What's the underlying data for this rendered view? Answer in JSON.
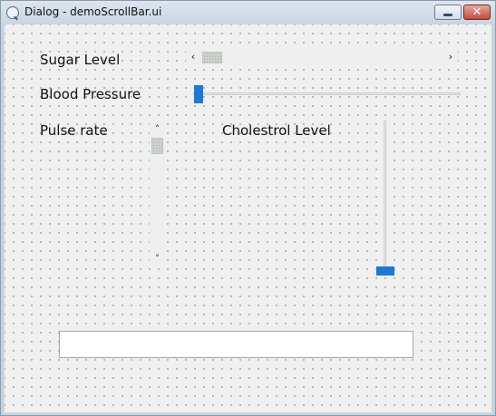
{
  "window": {
    "title": "Dialog - demoScrollBar.ui",
    "minimize_glyph": "minimize-icon",
    "close_glyph": "✕"
  },
  "labels": {
    "sugar_level": "Sugar Level",
    "blood_pressure": "Blood Pressure",
    "pulse_rate": "Pulse rate",
    "cholestrol_level": "Cholestrol Level"
  },
  "sugar_scrollbar": {
    "left_arrow": "‹",
    "right_arrow": "›",
    "value_fraction": 0.0
  },
  "blood_pressure_slider": {
    "value_fraction": 0.0
  },
  "pulse_scrollbar": {
    "up_arrow": "˄",
    "down_arrow": "˅",
    "value_fraction": 0.0
  },
  "cholestrol_slider": {
    "value_fraction": 0.0
  },
  "output_field": {
    "value": "",
    "placeholder": ""
  },
  "colors": {
    "slider_handle": "#1c79d6",
    "client_background": "#f0f0f0",
    "close_button": "#c8483a"
  }
}
